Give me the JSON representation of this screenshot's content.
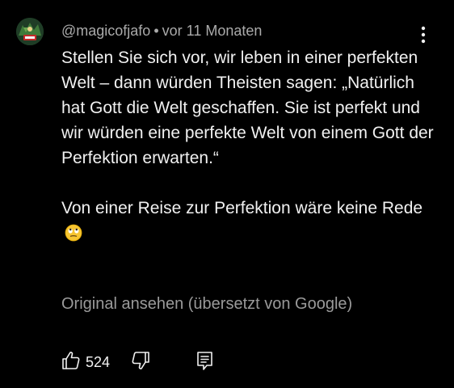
{
  "comment": {
    "author": "@magicofjafo",
    "separator": "•",
    "timestamp": "vor 11 Monaten",
    "paragraph1": "Stellen Sie sich vor, wir leben in einer perfekten Welt – dann würden Theisten sagen: „Natürlich hat Gott die Welt geschaffen. Sie ist perfekt und wir würden eine perfekte Welt von einem Gott der Perfektion erwarten.“",
    "paragraph2": "Von einer Reise zur Perfektion wäre keine Rede",
    "emoji": "face-with-rolling-eyes-emoji",
    "translate_link": "Original ansehen (übersetzt von Google)",
    "like_count": "524"
  },
  "icons": {
    "avatar": "avatar-image",
    "more": "more-vert-icon",
    "like": "thumb-up-icon",
    "dislike": "thumb-down-icon",
    "reply": "reply-comment-icon"
  },
  "colors": {
    "background": "#000000",
    "text": "#f1f1f1",
    "secondary_text": "#aaaaaa"
  }
}
